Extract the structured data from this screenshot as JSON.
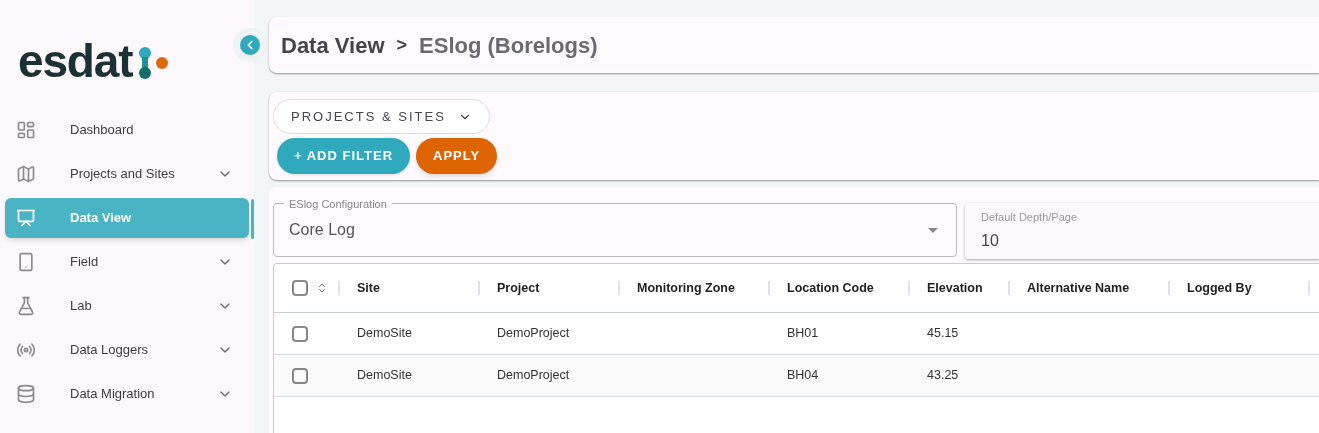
{
  "logo": {
    "text": "esdat"
  },
  "sidebar": {
    "items": [
      {
        "label": "Dashboard",
        "kind": "dashboard",
        "selected": false,
        "expandable": false
      },
      {
        "label": "Projects and Sites",
        "kind": "map",
        "selected": false,
        "expandable": true
      },
      {
        "label": "Data View",
        "kind": "chart",
        "selected": true,
        "expandable": false
      },
      {
        "label": "Field",
        "kind": "phone",
        "selected": false,
        "expandable": true
      },
      {
        "label": "Lab",
        "kind": "flask",
        "selected": false,
        "expandable": true
      },
      {
        "label": "Data Loggers",
        "kind": "antenna",
        "selected": false,
        "expandable": true
      },
      {
        "label": "Data Migration",
        "kind": "database",
        "selected": false,
        "expandable": true
      }
    ]
  },
  "breadcrumb": {
    "parent": "Data View",
    "separator": ">",
    "current": "ESlog (Borelogs)"
  },
  "filters": {
    "dropdown": "PROJECTS & SITES",
    "add_filter": "+ ADD FILTER",
    "apply": "APPLY"
  },
  "config": {
    "label": "ESlog Configuration",
    "value": "Core Log"
  },
  "depth": {
    "label": "Default Depth/Page",
    "value": "10"
  },
  "table": {
    "all_checked": false,
    "columns": [
      "Site",
      "Project",
      "Monitoring Zone",
      "Location Code",
      "Elevation",
      "Alternative Name",
      "Logged By"
    ],
    "rows": [
      {
        "checked": false,
        "cells": [
          "DemoSite",
          "DemoProject",
          "",
          "BH01",
          "45.15",
          "",
          ""
        ]
      },
      {
        "checked": false,
        "cells": [
          "DemoSite",
          "DemoProject",
          "",
          "BH04",
          "43.25",
          "",
          ""
        ]
      }
    ]
  }
}
